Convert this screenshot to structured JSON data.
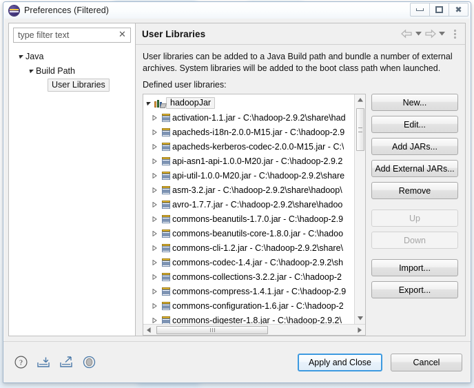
{
  "window": {
    "title": "Preferences (Filtered)",
    "app_icon": "eclipse-icon",
    "controls": {
      "minimize": "minimize-icon",
      "maximize": "maximize-icon",
      "close": "close-icon"
    }
  },
  "sidebar": {
    "filter": {
      "value": "type filter text",
      "placeholder": "type filter text",
      "clear_icon": "clear-icon"
    },
    "tree": [
      {
        "label": "Java",
        "level": 0,
        "expanded": true,
        "selected": false
      },
      {
        "label": "Build Path",
        "level": 1,
        "expanded": true,
        "selected": false
      },
      {
        "label": "User Libraries",
        "level": 2,
        "expanded": false,
        "selected": true
      }
    ]
  },
  "page": {
    "title": "User Libraries",
    "nav": {
      "back_icon": "back-arrow-icon",
      "back_caret_icon": "chevron-down-icon",
      "forward_icon": "forward-arrow-icon",
      "forward_caret_icon": "chevron-down-icon",
      "menu_icon": "view-menu-icon"
    },
    "description": "User libraries can be added to a Java Build path and bundle a number of external archives. System libraries will be added to the boot class path when launched.",
    "list_label": "Defined user libraries:"
  },
  "library_tree": {
    "root": {
      "label": "hadoopJar",
      "icon": "library-books-icon",
      "expanded": true,
      "selected": true
    },
    "children": [
      {
        "label": "activation-1.1.jar - C:\\hadoop-2.9.2\\share\\had",
        "icon": "jar-icon"
      },
      {
        "label": "apacheds-i18n-2.0.0-M15.jar - C:\\hadoop-2.9",
        "icon": "jar-icon"
      },
      {
        "label": "apacheds-kerberos-codec-2.0.0-M15.jar - C:\\",
        "icon": "jar-icon"
      },
      {
        "label": "api-asn1-api-1.0.0-M20.jar - C:\\hadoop-2.9.2",
        "icon": "jar-icon"
      },
      {
        "label": "api-util-1.0.0-M20.jar - C:\\hadoop-2.9.2\\share",
        "icon": "jar-icon"
      },
      {
        "label": "asm-3.2.jar - C:\\hadoop-2.9.2\\share\\hadoop\\",
        "icon": "jar-icon"
      },
      {
        "label": "avro-1.7.7.jar - C:\\hadoop-2.9.2\\share\\hadoo",
        "icon": "jar-icon"
      },
      {
        "label": "commons-beanutils-1.7.0.jar - C:\\hadoop-2.9",
        "icon": "jar-icon"
      },
      {
        "label": "commons-beanutils-core-1.8.0.jar - C:\\hadoo",
        "icon": "jar-icon"
      },
      {
        "label": "commons-cli-1.2.jar - C:\\hadoop-2.9.2\\share\\",
        "icon": "jar-icon"
      },
      {
        "label": "commons-codec-1.4.jar - C:\\hadoop-2.9.2\\sh",
        "icon": "jar-icon"
      },
      {
        "label": "commons-collections-3.2.2.jar - C:\\hadoop-2",
        "icon": "jar-icon"
      },
      {
        "label": "commons-compress-1.4.1.jar - C:\\hadoop-2.9",
        "icon": "jar-icon"
      },
      {
        "label": "commons-configuration-1.6.jar - C:\\hadoop-2",
        "icon": "jar-icon"
      },
      {
        "label": "commons-digester-1.8.jar - C:\\hadoop-2.9.2\\",
        "icon": "jar-icon"
      }
    ]
  },
  "side_buttons": [
    {
      "label": "New...",
      "enabled": true
    },
    {
      "label": "Edit...",
      "enabled": true
    },
    {
      "label": "Add JARs...",
      "enabled": true
    },
    {
      "label": "Add External JARs...",
      "enabled": true
    },
    {
      "label": "Remove",
      "enabled": true
    },
    {
      "label": "Up",
      "enabled": false
    },
    {
      "label": "Down",
      "enabled": false
    },
    {
      "label": "Import...",
      "enabled": true
    },
    {
      "label": "Export...",
      "enabled": true
    }
  ],
  "footer": {
    "icons": [
      {
        "name": "help-icon"
      },
      {
        "name": "import-preferences-icon"
      },
      {
        "name": "export-preferences-icon"
      },
      {
        "name": "restore-defaults-icon"
      }
    ],
    "apply_label": "Apply and Close",
    "cancel_label": "Cancel"
  },
  "colors": {
    "accent": "#3d9ae0",
    "dialog_bg": "#f0f0f0",
    "list_bg": "#ffffff",
    "border": "#bfbfbf"
  }
}
